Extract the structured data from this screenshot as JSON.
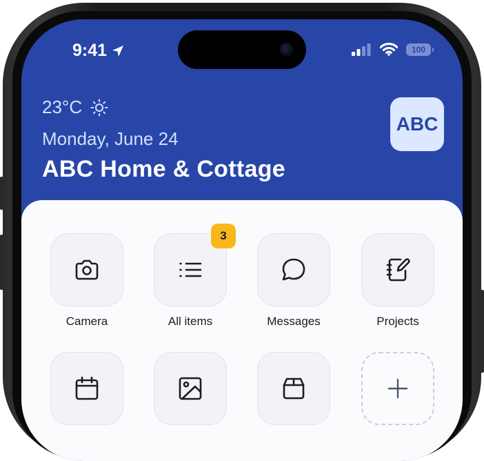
{
  "status_bar": {
    "time": "9:41",
    "battery_level": "100"
  },
  "header": {
    "temperature": "23°C",
    "weather_icon": "sun-icon",
    "date": "Monday, June 24",
    "store_name": "ABC Home & Cottage",
    "logo_text": "ABC",
    "background_color": "#2846a8"
  },
  "tiles": [
    {
      "label": "Camera",
      "icon": "camera-icon"
    },
    {
      "label": "All items",
      "icon": "list-icon",
      "badge": "3"
    },
    {
      "label": "Messages",
      "icon": "chat-bubble-icon"
    },
    {
      "label": "Projects",
      "icon": "notebook-pen-icon"
    },
    {
      "label": "",
      "icon": "calendar-icon"
    },
    {
      "label": "",
      "icon": "image-icon"
    },
    {
      "label": "",
      "icon": "box-icon"
    },
    {
      "label": "",
      "icon": "plus-icon"
    }
  ],
  "colors": {
    "badge": "#f9b81a",
    "tile_background": "#f1f3f9"
  }
}
